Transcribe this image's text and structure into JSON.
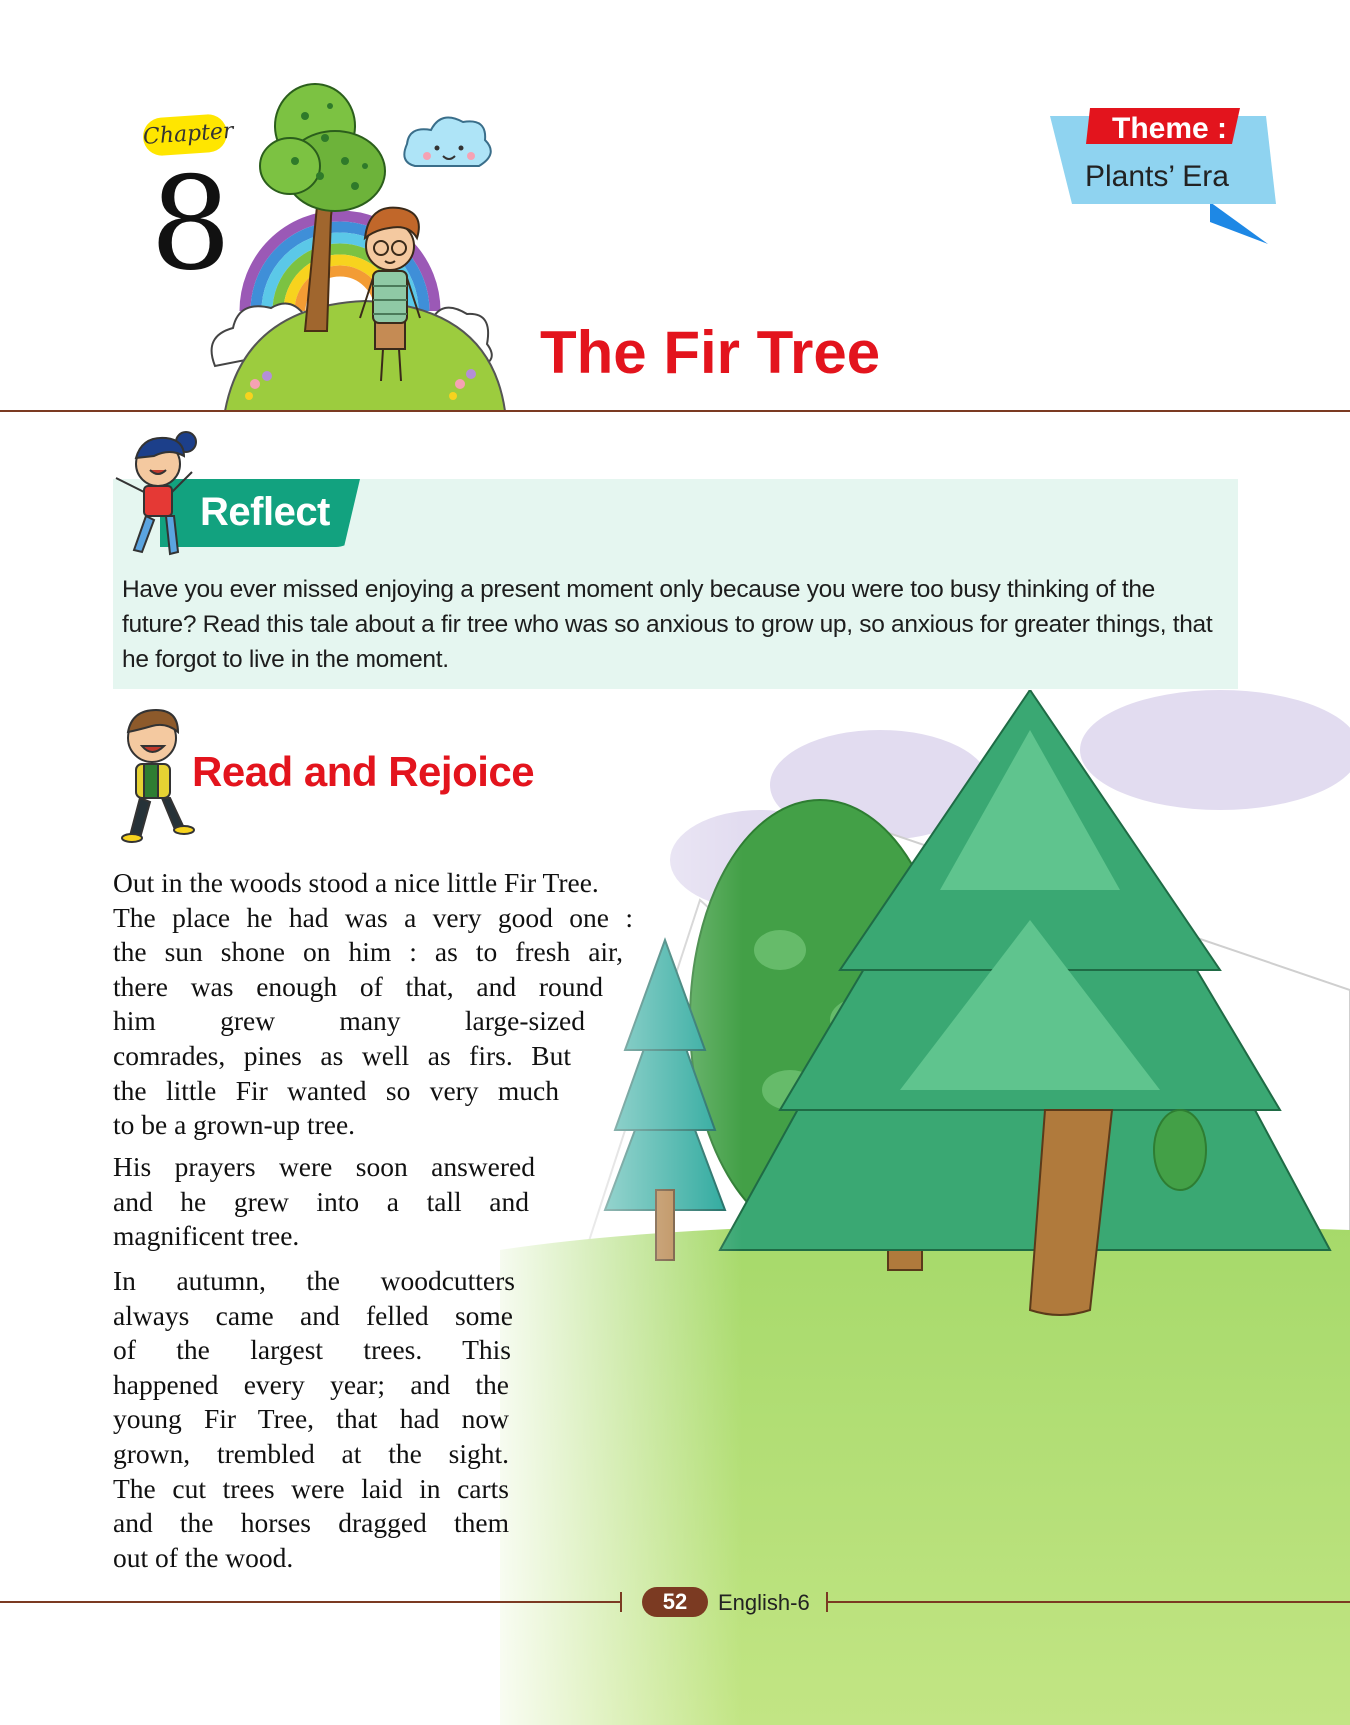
{
  "header": {
    "chapter_label": "Chapter",
    "chapter_number": "8",
    "theme_label": "Theme :",
    "theme_value": "Plants’ Era",
    "title": "The Fir Tree"
  },
  "reflect": {
    "heading": "Reflect",
    "text": "Have you ever missed enjoying a present moment only because you were too busy thinking of the future? Read this tale about a fir tree who was so anxious to grow up, so anxious for greater things, that he forgot to live in the moment."
  },
  "read_and_rejoice": {
    "heading": "Read and Rejoice",
    "paragraphs": [
      {
        "lines": [
          "Out in the woods stood a nice little Fir Tree.",
          "The place he had was a very good one :",
          "the sun shone on him : as to fresh air,",
          "there was enough of that, and round",
          "him grew many large-sized",
          "comrades, pines as well as firs. But",
          "the little Fir wanted so very much",
          "to be a grown-up tree."
        ]
      },
      {
        "lines": [
          "His prayers were soon answered",
          "and he grew into a tall and",
          "magnificent tree."
        ]
      },
      {
        "lines": [
          "In autumn, the woodcutters",
          "always came and felled some",
          "of the largest trees. This",
          "happened every year; and the",
          "young Fir Tree, that had now",
          "grown, trembled at the sight.",
          "The cut trees were laid in carts",
          "and the horses dragged them",
          "out of the wood."
        ]
      }
    ]
  },
  "footer": {
    "page_number": "52",
    "book_name": "English-6"
  },
  "colors": {
    "title_red": "#e3141d",
    "reflect_green": "#12a27f",
    "reflect_bg": "#e5f6f0",
    "rule_brown": "#7b3a22",
    "chapter_yellow": "#ffe600",
    "theme_blue": "#8fd3f0"
  }
}
